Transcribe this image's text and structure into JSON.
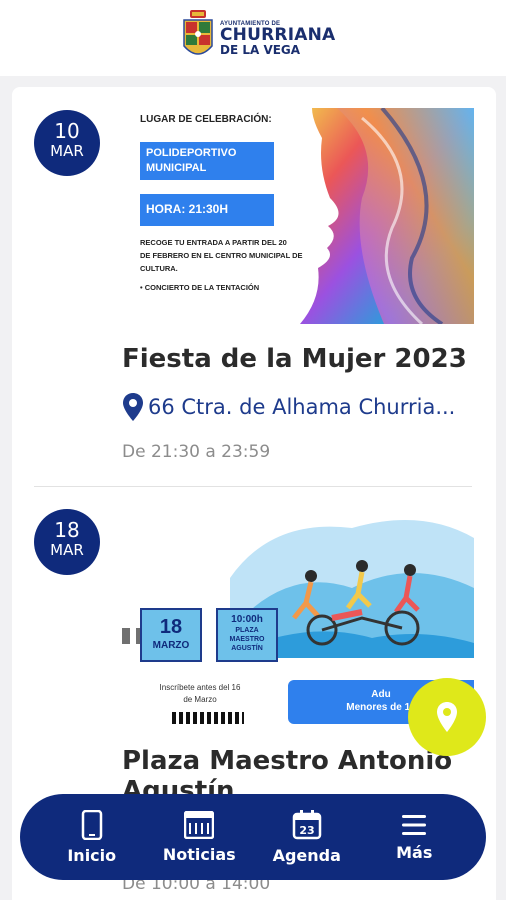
{
  "header": {
    "logo_small": "AYUNTAMIENTO DE",
    "logo_line1": "CHURRIANA",
    "logo_line2": "DE LA VEGA"
  },
  "events": [
    {
      "day": "10",
      "month": "MAR",
      "poster": {
        "lugar_label": "LUGAR DE CELEBRACIÓN:",
        "venue_line1": "POLIDEPORTIVO",
        "venue_line2": "MUNICIPAL",
        "hora": "HORA: 21:30H",
        "info_line1": "RECOGE TU ENTRADA A PARTIR DEL 20",
        "info_line2": "DE FEBRERO EN EL CENTRO MUNICIPAL DE",
        "info_line3": "CULTURA.",
        "bullet1": "• CONCIERTO DE LA TENTACIÓN"
      },
      "title": "Fiesta de la Mujer 2023",
      "location": "66 Ctra. de Alhama Churria...",
      "time": "De 21:30 a 23:59"
    },
    {
      "day": "18",
      "month": "MAR",
      "poster": {
        "date_day": "18",
        "date_month": "MARZO",
        "hour": "10:00h",
        "place1": "PLAZA",
        "place2": "MAESTRO",
        "place3": "AGUSTÍN",
        "inscribe1": "Inscríbete antes del 16",
        "inscribe2": "de Marzo",
        "price1": "Adu",
        "price2": "Menores de 13"
      },
      "title_line1": "Plaza Maestro Antonio",
      "title_line2": "Agustín",
      "time": "De 10:00 a 14:00"
    }
  ],
  "nav": {
    "items": [
      {
        "label": "Inicio",
        "icon": "phone-icon"
      },
      {
        "label": "Noticias",
        "icon": "newspaper-icon"
      },
      {
        "label": "Agenda",
        "icon": "calendar-icon",
        "calendar_number": "23"
      },
      {
        "label": "Más",
        "icon": "menu-icon"
      }
    ]
  },
  "colors": {
    "primary": "#0f2a7c",
    "accent": "#dfe81a",
    "link": "#1e3b8c"
  }
}
